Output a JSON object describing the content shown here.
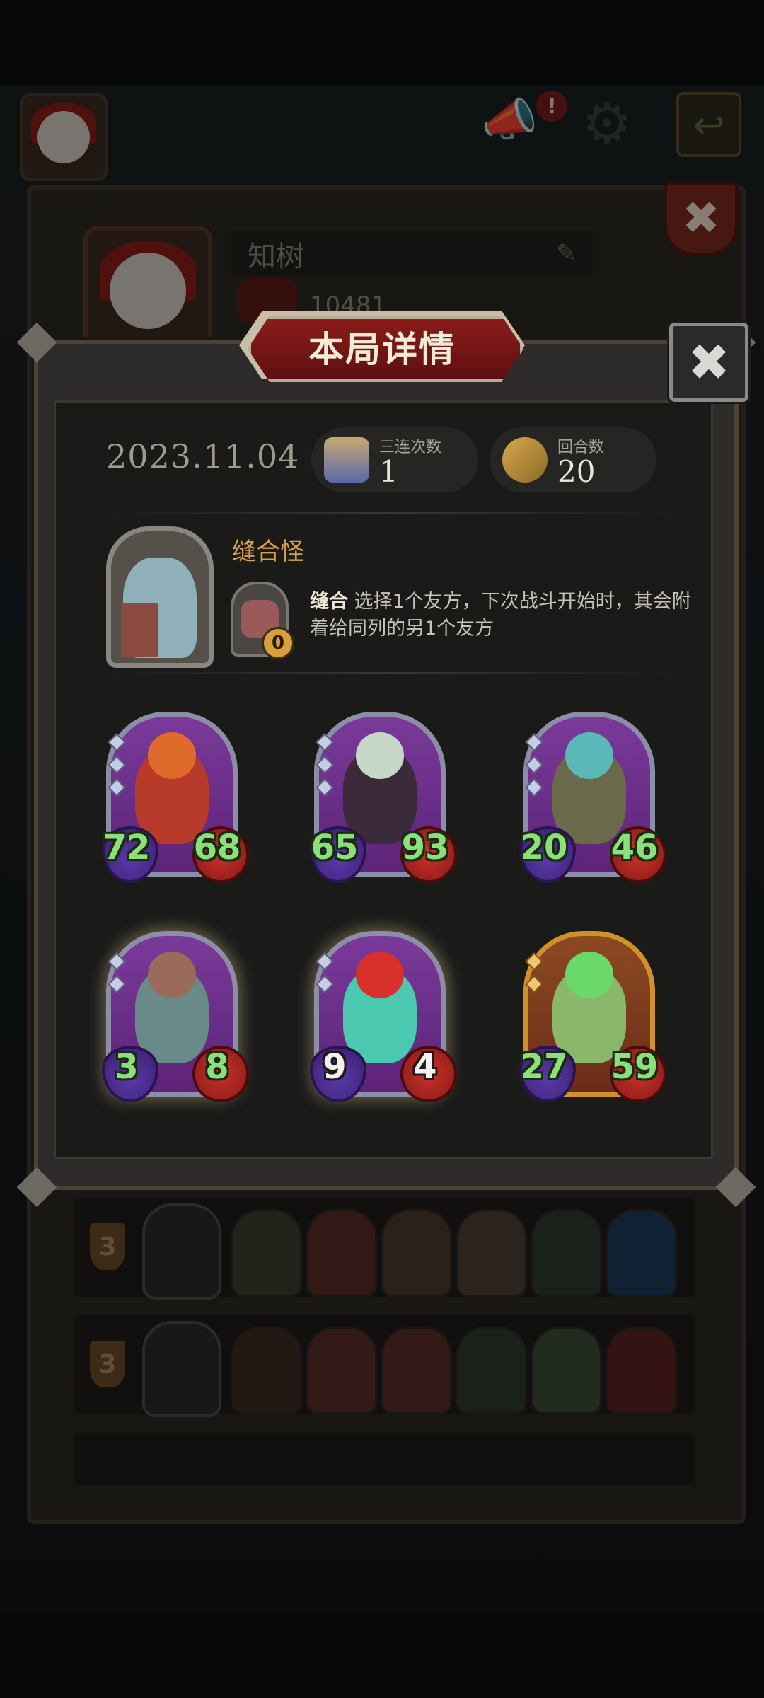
{
  "topbar": {
    "notification_badge": "!",
    "icons": [
      "avatar",
      "megaphone-icon",
      "gear-icon",
      "exit-icon"
    ]
  },
  "profile": {
    "name": "知树",
    "score": "10481"
  },
  "modal": {
    "title": "本局详情",
    "date": "2023.11.04",
    "stats": [
      {
        "label": "三连次数",
        "value": "1",
        "icon": "triple-icon"
      },
      {
        "label": "回合数",
        "value": "20",
        "icon": "rounds-icon"
      }
    ],
    "hero": {
      "name": "缝合怪",
      "skill_counter": "0",
      "skill_name": "缝合",
      "skill_desc": "选择1个友方，下次战斗开始时，其会附着给同列的另1个友方"
    },
    "units": [
      {
        "attack": "72",
        "health": "68",
        "tier_gems": 3,
        "frame": "silver",
        "hp_white": false
      },
      {
        "attack": "65",
        "health": "93",
        "tier_gems": 3,
        "frame": "silver",
        "hp_white": false
      },
      {
        "attack": "20",
        "health": "46",
        "tier_gems": 3,
        "frame": "silver",
        "hp_white": false
      },
      {
        "attack": "3",
        "health": "8",
        "tier_gems": 2,
        "frame": "silver",
        "hp_white": false
      },
      {
        "attack": "9",
        "health": "4",
        "tier_gems": 2,
        "frame": "silver",
        "hp_white": true
      },
      {
        "attack": "27",
        "health": "59",
        "tier_gems": 2,
        "frame": "gold",
        "hp_white": false
      }
    ]
  },
  "history": [
    {
      "rank": "3"
    },
    {
      "rank": "3"
    }
  ],
  "colors": {
    "accent_gold": "#d9a047",
    "banner_red": "#8a1c1a",
    "stat_green": "#8be07a"
  }
}
